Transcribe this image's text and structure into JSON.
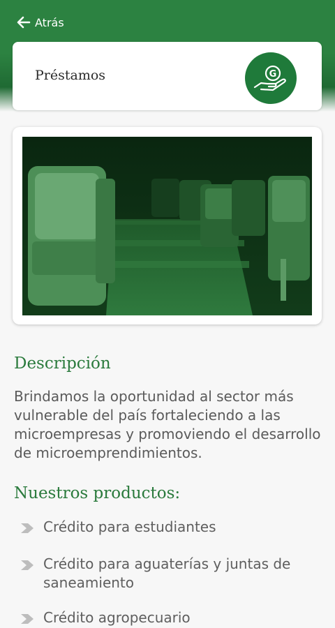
{
  "nav": {
    "back_label": "Atrás"
  },
  "header": {
    "title": "Préstamos",
    "icon": "hand-holding-coin-icon",
    "icon_letter": "G"
  },
  "image": {
    "description_icon": "cinema-seats-photo"
  },
  "description": {
    "title": "Descripción",
    "text": "Brindamos la oportunidad al sector más vulnerable del país fortaleciendo a las microempresas y promoviendo el desarrollo de microemprendimientos."
  },
  "products": {
    "title": "Nuestros productos:",
    "items": [
      {
        "label": "Crédito para estudiantes"
      },
      {
        "label": "Crédito para aguaterías y juntas de saneamiento"
      },
      {
        "label": "Crédito agropecuario"
      }
    ]
  },
  "colors": {
    "brand_green": "#2c8241",
    "icon_green": "#1f7a3a",
    "title_green": "#2a7a3c",
    "bullet_gray": "#bdbdbd"
  }
}
